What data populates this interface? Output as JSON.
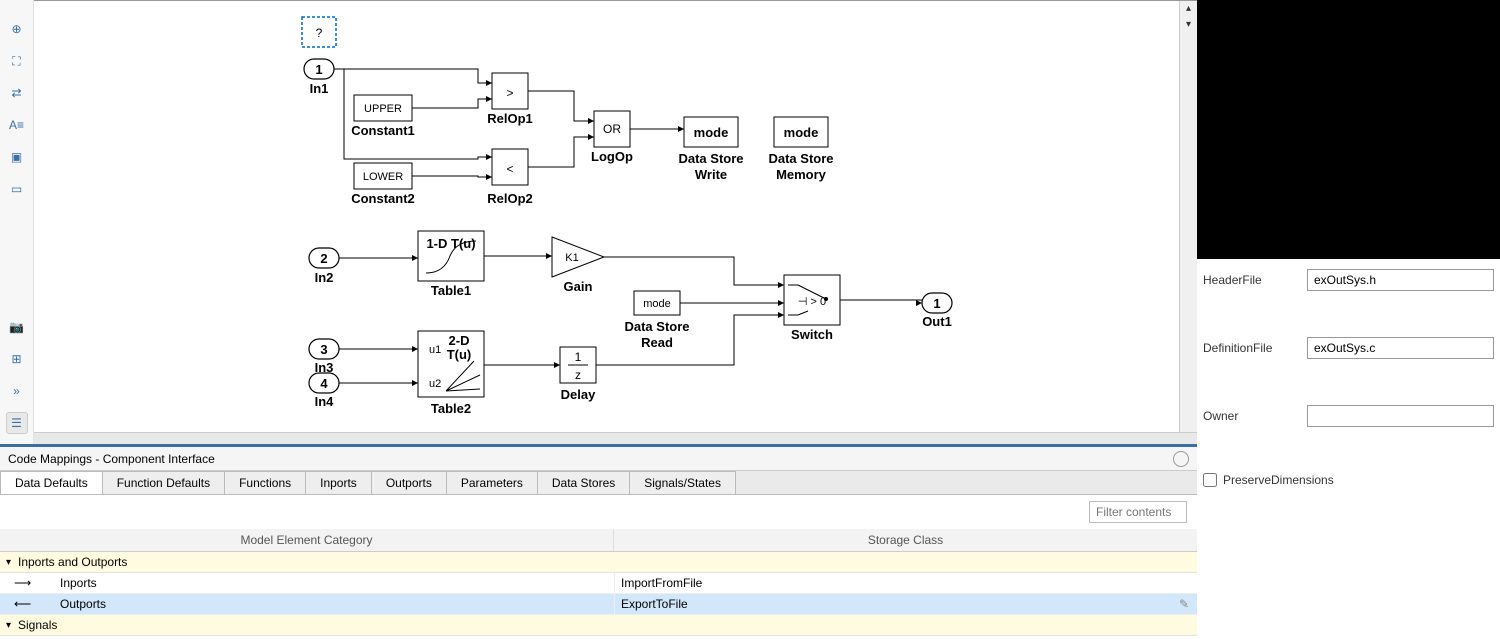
{
  "canvas": {
    "hint": "?",
    "in1_port": "1",
    "in1_label": "In1",
    "const1_box": "UPPER",
    "const1_label": "Constant1",
    "const2_box": "LOWER",
    "const2_label": "Constant2",
    "relop1_box": ">",
    "relop1_label": "RelOp1",
    "relop2_box": "<",
    "relop2_label": "RelOp2",
    "logop_box": "OR",
    "logop_label": "LogOp",
    "dswrite_box": "mode",
    "dswrite_label1": "Data Store",
    "dswrite_label2": "Write",
    "dsmem_box": "mode",
    "dsmem_label1": "Data Store",
    "dsmem_label2": "Memory",
    "in2_port": "2",
    "in2_label": "In2",
    "table1_box": "1-D T(u)",
    "table1_label": "Table1",
    "gain_box": "K1",
    "gain_label": "Gain",
    "dsread_box": "mode",
    "dsread_label1": "Data Store",
    "dsread_label2": "Read",
    "switch_box": "⊣ > 0",
    "switch_label": "Switch",
    "out1_port": "1",
    "out1_label": "Out1",
    "in3_port": "3",
    "in3_label": "In3",
    "in4_port": "4",
    "in4_label": "In4",
    "table2_top": "2-D",
    "table2_tu": "T(u)",
    "table2_u1": "u1",
    "table2_u2": "u2",
    "table2_label": "Table2",
    "delay_label": "Delay",
    "delay_num": "1",
    "delay_den": "z"
  },
  "dock": {
    "title": "Code Mappings - Component Interface",
    "tabs": [
      "Data Defaults",
      "Function Defaults",
      "Functions",
      "Inports",
      "Outports",
      "Parameters",
      "Data Stores",
      "Signals/States"
    ],
    "active_tab": 0,
    "filter_placeholder": "Filter contents",
    "col1": "Model Element Category",
    "col2": "Storage Class",
    "group1": "Inports and Outports",
    "row_inports_name": "Inports",
    "row_inports_value": "ImportFromFile",
    "row_outports_name": "Outports",
    "row_outports_value": "ExportToFile",
    "group2": "Signals"
  },
  "rp": {
    "headerfile_label": "HeaderFile",
    "headerfile_value": "exOutSys.h",
    "definitionfile_label": "DefinitionFile",
    "definitionfile_value": "exOutSys.c",
    "owner_label": "Owner",
    "owner_value": "",
    "preservedims_label": "PreserveDimensions"
  }
}
